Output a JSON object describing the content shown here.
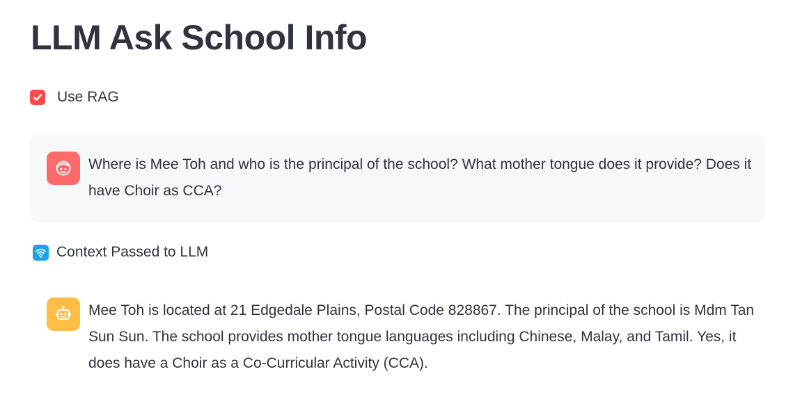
{
  "page": {
    "title": "LLM Ask School Info"
  },
  "controls": {
    "use_rag": {
      "label": "Use RAG",
      "checked": true
    }
  },
  "chat": {
    "user_message": {
      "avatar_icon": "smiley-face-icon",
      "text": "Where is Mee Toh and who is the principal of the school? What mother tongue does it provide? Does it have Choir as CCA?"
    },
    "context": {
      "icon": "wifi-signal-icon",
      "label": "Context Passed to LLM"
    },
    "assistant_message": {
      "avatar_icon": "robot-icon",
      "text": "Mee Toh is located at 21 Edgedale Plains, Postal Code 828867. The principal of the school is Mdm Tan Sun Sun. The school provides mother tongue languages including Chinese, Malay, and Tamil. Yes, it does have a Choir as a Co-Curricular Activity (CCA)."
    }
  },
  "colors": {
    "text": "#31333f",
    "checkbox_accent": "#ff4b4b",
    "user_avatar": "#ff6b6b",
    "assistant_avatar": "#ffbd45",
    "context_icon": "#1aa6e6",
    "user_message_background": "#f7f8fa"
  }
}
